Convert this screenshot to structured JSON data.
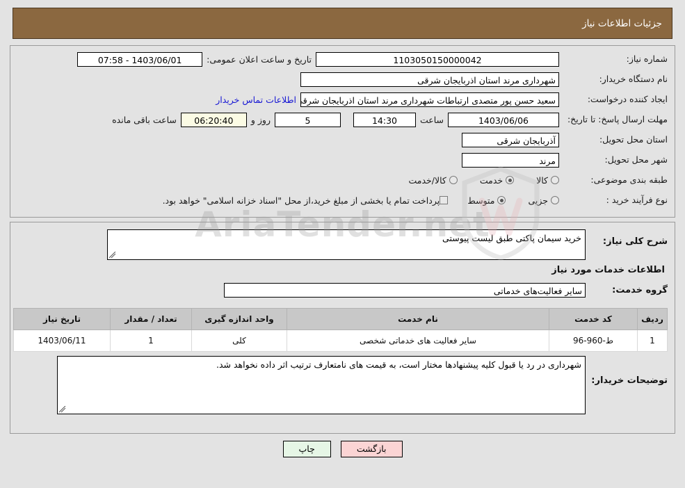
{
  "header": {
    "title": "جزئیات اطلاعات نیاز"
  },
  "top_form": {
    "need_number": {
      "label": "شماره نیاز:",
      "value": "1103050150000042"
    },
    "announce_datetime": {
      "label": "تاریخ و ساعت اعلان عمومی:",
      "value": "1403/06/01 - 07:58"
    },
    "buyer_org": {
      "label": "نام دستگاه خریدار:",
      "value": "شهرداری مرند استان اذربایجان شرقی"
    },
    "request_creator": {
      "label": "ایجاد کننده درخواست:",
      "value": "سعید حسن پور متصدی ارتباطات شهرداری مرند استان اذربایجان شرقی"
    },
    "contact_link": "اطلاعات تماس خریدار",
    "deadline": {
      "label": "مهلت ارسال پاسخ: تا تاریخ:",
      "date": "1403/06/06",
      "time_label": "ساعت",
      "time": "14:30",
      "days": "5",
      "days_label": "روز و",
      "countdown": "06:20:40",
      "remaining_label": "ساعت باقی مانده"
    },
    "delivery_province": {
      "label": "استان محل تحویل:",
      "value": "آذربایجان شرقی"
    },
    "delivery_city": {
      "label": "شهر محل تحویل:",
      "value": "مرند"
    },
    "category": {
      "label": "طبقه بندی موضوعی:",
      "options": [
        {
          "label": "کالا",
          "selected": false
        },
        {
          "label": "خدمت",
          "selected": true
        },
        {
          "label": "کالا/خدمت",
          "selected": false
        }
      ]
    },
    "process_type": {
      "label": "نوع فرآیند خرید :",
      "options": [
        {
          "label": "جزیی",
          "selected": false
        },
        {
          "label": "متوسط",
          "selected": true
        }
      ],
      "checkbox_label": "پرداخت تمام یا بخشی از مبلغ خرید،از محل \"اسناد خزانه اسلامی\" خواهد بود.",
      "checkbox_checked": false
    }
  },
  "mid_form": {
    "need_description": {
      "label": "شرح کلی نیاز:",
      "value": "خرید سیمان پاکتی طبق لیست پیوستی"
    },
    "services_section_title": "اطلاعات خدمات مورد نیاز",
    "service_group": {
      "label": "گروه خدمت:",
      "value": "سایر فعالیت‌های خدماتی"
    },
    "table": {
      "columns": [
        "ردیف",
        "کد خدمت",
        "نام خدمت",
        "واحد اندازه گیری",
        "تعداد / مقدار",
        "تاریخ نیاز"
      ],
      "rows": [
        [
          "1",
          "ط-960-96",
          "سایر فعالیت های خدماتی شخصی",
          "کلی",
          "1",
          "1403/06/11"
        ]
      ]
    },
    "buyer_notes": {
      "label": "توضیحات خریدار:",
      "value": "شهرداری در رد یا قبول کلیه پیشنهادها مختار است، به قیمت های نامتعارف ترتیب اثر داده نخواهد شد."
    }
  },
  "buttons": {
    "print": "چاپ",
    "back": "بازگشت"
  },
  "watermark": {
    "text": "AriaTender.net"
  },
  "colors": {
    "header_bg": "#8b6840",
    "page_bg": "#e3e3e3",
    "link": "#1717d4",
    "print_btn": "#e6f6e6",
    "back_btn": "#fbd4d4",
    "timer_bg": "#fbfbe4",
    "table_header_bg": "#c8c8c8"
  }
}
